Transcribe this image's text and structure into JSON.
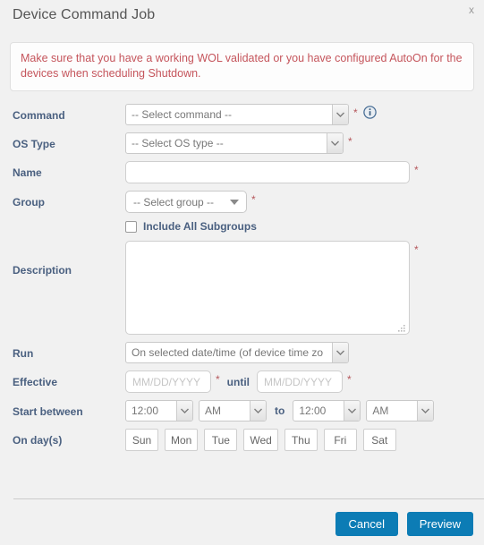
{
  "dialog": {
    "title": "Device Command Job",
    "close_label": "x",
    "warning": "Make sure that you have a working WOL validated or you have configured AutoOn for the devices when scheduling Shutdown."
  },
  "fields": {
    "command": {
      "label": "Command",
      "value": "-- Select command --",
      "required_marker": "*",
      "info_icon": "info-circle-icon"
    },
    "os_type": {
      "label": "OS Type",
      "value": "-- Select OS type --",
      "required_marker": "*"
    },
    "name": {
      "label": "Name",
      "value": "",
      "placeholder": "",
      "required_marker": "*"
    },
    "group": {
      "label": "Group",
      "value": "-- Select group --",
      "required_marker": "*"
    },
    "include_subgroups": {
      "label": "Include All Subgroups",
      "checked": false
    },
    "description": {
      "label": "Description",
      "value": "",
      "placeholder": "",
      "required_marker": "*"
    },
    "run": {
      "label": "Run",
      "value": "On selected date/time (of device time zo"
    },
    "effective": {
      "label": "Effective",
      "from_placeholder": "MM/DD/YYYY",
      "from_value": "",
      "until_label": "until",
      "to_placeholder": "MM/DD/YYYY",
      "to_value": "",
      "required_marker": "*"
    },
    "start_between": {
      "label": "Start between",
      "from_time": "12:00",
      "from_meridiem": "AM",
      "to_word": "to",
      "to_time": "12:00",
      "to_meridiem": "AM"
    },
    "on_days": {
      "label": "On day(s)",
      "days": [
        "Sun",
        "Mon",
        "Tue",
        "Wed",
        "Thu",
        "Fri",
        "Sat"
      ]
    }
  },
  "footer": {
    "cancel_label": "Cancel",
    "preview_label": "Preview"
  },
  "colors": {
    "accent_blue": "#0c7cb5",
    "warning_text": "#c5555c",
    "label_text": "#4a6080",
    "required_star": "#b5575c",
    "page_background": "#f1f1f1"
  }
}
